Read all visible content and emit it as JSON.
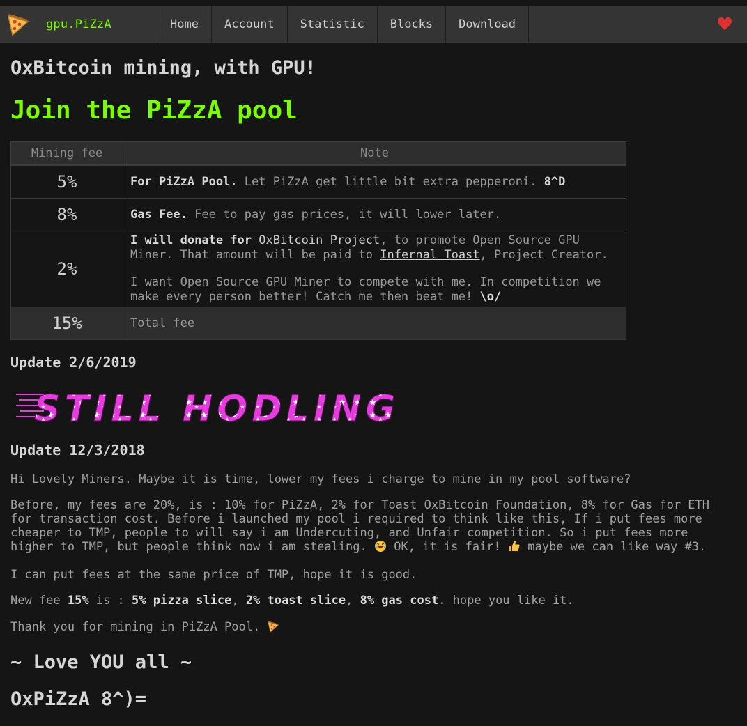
{
  "nav": {
    "brand": "gpu.PiZzA",
    "items": [
      "Home",
      "Account",
      "Statistic",
      "Blocks",
      "Download"
    ]
  },
  "main": {
    "title": "OxBitcoin mining, with GPU!",
    "join_heading": "Join the PiZzA pool",
    "table": {
      "headers": [
        "Mining fee",
        "Note"
      ],
      "rows": [
        {
          "fee": "5%",
          "bold": "For PiZzA Pool.",
          "text": " Let PiZzA get little bit extra pepperoni. ",
          "tail_bold": "8^D"
        },
        {
          "fee": "8%",
          "bold": "Gas Fee.",
          "text": " Fee to pay gas prices, it will lower later."
        },
        {
          "fee": "2%",
          "bold": "I will donate for ",
          "link1": "OxBitcoin Project",
          "text_a": ", to promote Open Source GPU Miner. That amount will be paid to ",
          "link2": "Infernal Toast",
          "text_b": ", Project Creator.",
          "para2": "I want Open Source GPU Miner to compete with me. In competition we make every person better! Catch me then beat me! ",
          "para2_bold": "\\o/"
        },
        {
          "fee": "15%",
          "text": "Total fee"
        }
      ]
    },
    "update1": "Update 2/6/2019",
    "hodl_banner": "STILL HODLING",
    "update2": "Update 12/3/2018",
    "p1": "Hi Lovely Miners. Maybe it is time, lower my fees i charge to mine in my pool software?",
    "p2": "Before, my fees are 20%, is : 10% for PiZzA, 2% for Toast OxBitcoin Foundation, 8% for Gas for ETH for transaction cost. Before i launched my pool i required to think like this, If i put fees more cheaper to TMP, people to will say i am Undercuting, and Unfair competition. So i put fees more higher to TMP, but people think now i am stealing.",
    "p2_tail1": " OK, it is fair! ",
    "p2_tail2": " maybe we can like way #3.",
    "p3": "I can put fees at the same price of TMP, hope it is good.",
    "p4": {
      "a": "New fee ",
      "b1": "15%",
      "c": " is : ",
      "b2": "5% pizza slice",
      "d": ", ",
      "b3": "2% toast slice",
      "e": ", ",
      "b4": "8% gas cost",
      "f": ". hope you like it."
    },
    "p5": "Thank you for mining in PiZzA Pool.",
    "love": "~ Love YOU all ~",
    "signature": "OxPiZzA 8^)="
  },
  "colors": {
    "accent": "#7cfc00",
    "background": "#151515",
    "navbar": "#343434",
    "banner": "#e73be0"
  },
  "icons": [
    "pizza-icon",
    "heart-icon",
    "laugh-emoji-icon",
    "thumbs-up-icon"
  ]
}
